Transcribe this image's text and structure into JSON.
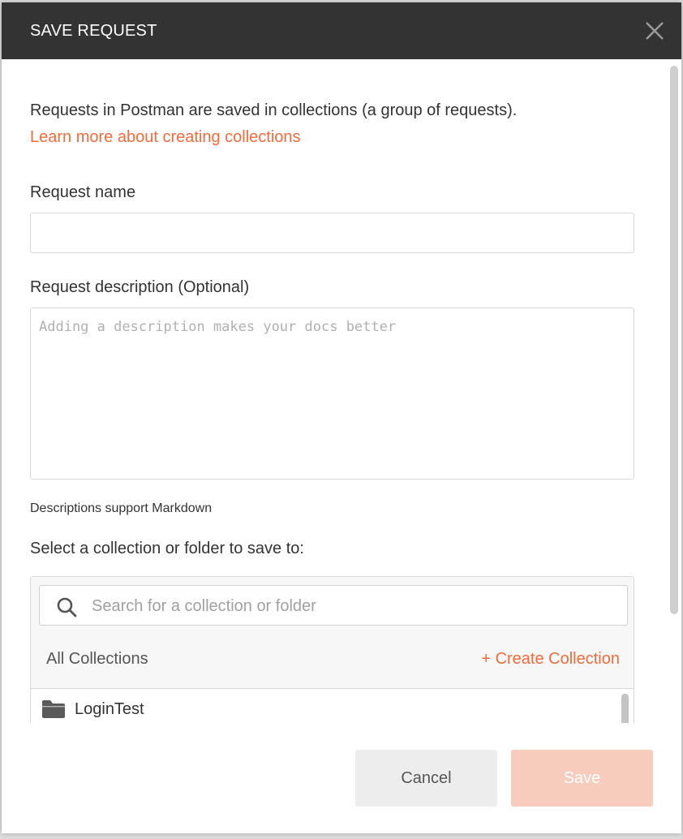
{
  "header": {
    "title": "SAVE REQUEST",
    "close_icon": "close-icon"
  },
  "intro": {
    "text": "Requests in Postman are saved in collections (a group of requests).",
    "link_text": "Learn more about creating collections"
  },
  "form": {
    "name_label": "Request name",
    "name_value": "",
    "description_label": "Request description (Optional)",
    "description_placeholder": "Adding a description makes your docs better",
    "markdown_note": "Descriptions support Markdown",
    "collection_label": "Select a collection or folder to save to:"
  },
  "collections": {
    "search_placeholder": "Search for a collection or folder",
    "all_label": "All Collections",
    "create_label": "+ Create Collection",
    "items": [
      {
        "name": "LoginTest",
        "icon": "folder-icon"
      }
    ]
  },
  "footer": {
    "cancel_label": "Cancel",
    "save_label": "Save"
  },
  "colors": {
    "header_bg": "#333333",
    "accent": "#f26b3a",
    "save_disabled_bg": "#f8ccbc",
    "cancel_bg": "#ededed"
  }
}
